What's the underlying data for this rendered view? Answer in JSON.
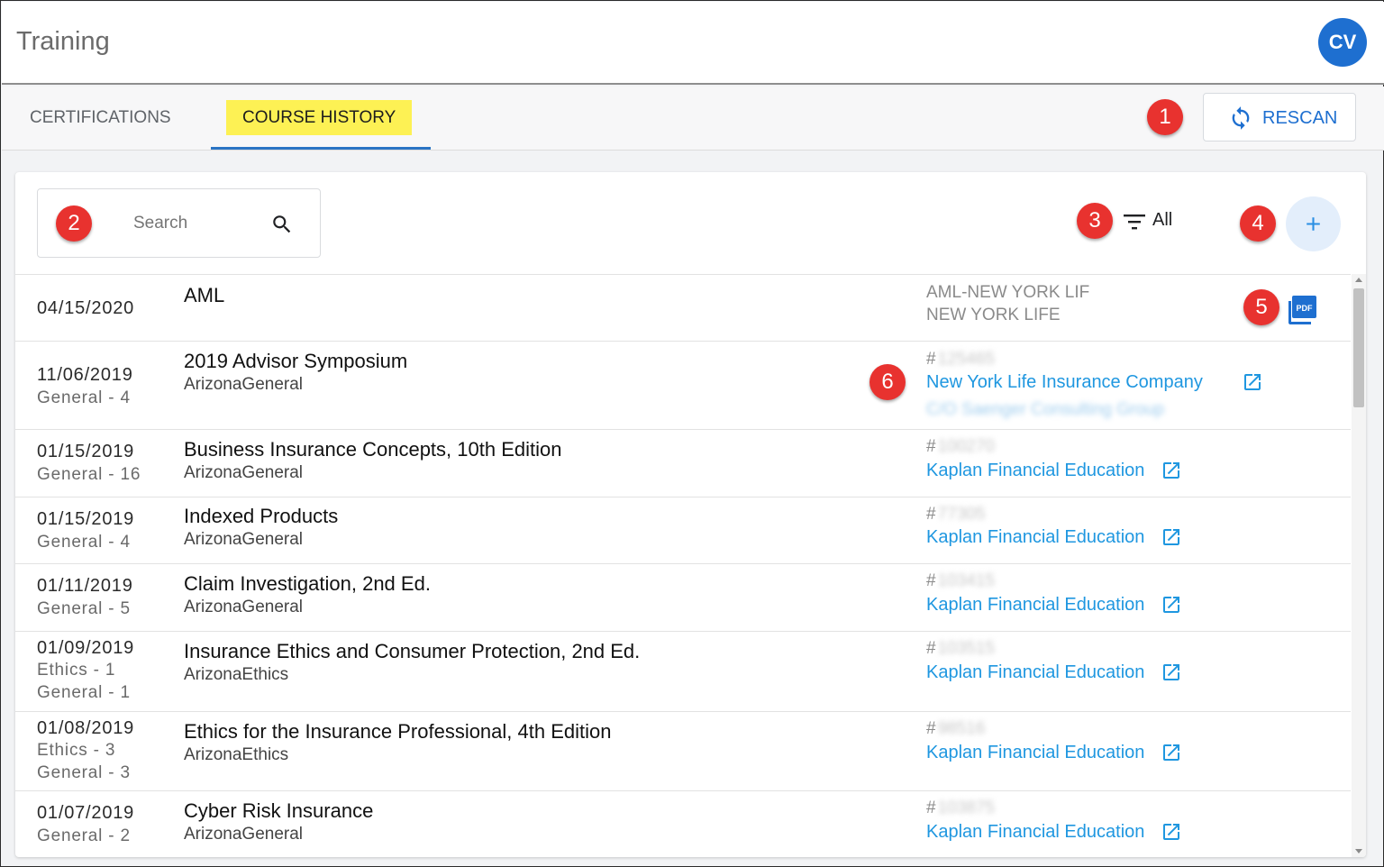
{
  "header": {
    "title": "Training",
    "avatar_initials": "CV"
  },
  "tabs": [
    {
      "label": "CERTIFICATIONS",
      "active": false
    },
    {
      "label": "COURSE HISTORY",
      "active": true
    }
  ],
  "toolbar": {
    "rescan_label": "RESCAN"
  },
  "search": {
    "placeholder": "Search"
  },
  "filter": {
    "label": "All"
  },
  "courses": [
    {
      "date": "04/15/2020",
      "credits": [],
      "title": "AML",
      "category": "",
      "provider_line1": "AML-NEW YORK LIF",
      "provider_line2": "NEW YORK LIFE",
      "has_pdf": true
    },
    {
      "date": "11/06/2019",
      "credits": [
        "General - 4"
      ],
      "title": "2019 Advisor Symposium",
      "category": "ArizonaGeneral",
      "number": "125465",
      "provider": "New York Life Insurance Company",
      "provider_extra": "C/O Saenger Consulting Group"
    },
    {
      "date": "01/15/2019",
      "credits": [
        "General - 16"
      ],
      "title": "Business Insurance Concepts, 10th Edition",
      "category": "ArizonaGeneral",
      "number": "100270",
      "provider": "Kaplan Financial Education"
    },
    {
      "date": "01/15/2019",
      "credits": [
        "General - 4"
      ],
      "title": "Indexed Products",
      "category": "ArizonaGeneral",
      "number": "77305",
      "provider": "Kaplan Financial Education"
    },
    {
      "date": "01/11/2019",
      "credits": [
        "General - 5"
      ],
      "title": "Claim Investigation, 2nd Ed.",
      "category": "ArizonaGeneral",
      "number": "103415",
      "provider": "Kaplan Financial Education"
    },
    {
      "date": "01/09/2019",
      "credits": [
        "Ethics - 1",
        "General - 1"
      ],
      "title": "Insurance Ethics and Consumer Protection, 2nd Ed.",
      "category": "ArizonaEthics",
      "number": "103515",
      "provider": "Kaplan Financial Education"
    },
    {
      "date": "01/08/2019",
      "credits": [
        "Ethics - 3",
        "General - 3"
      ],
      "title": "Ethics for the Insurance Professional, 4th Edition",
      "category": "ArizonaEthics",
      "number": "98516",
      "provider": "Kaplan Financial Education"
    },
    {
      "date": "01/07/2019",
      "credits": [
        "General - 2"
      ],
      "title": "Cyber Risk Insurance",
      "category": "ArizonaGeneral",
      "number": "103875",
      "provider": "Kaplan Financial Education"
    }
  ],
  "markers": [
    "1",
    "2",
    "3",
    "4",
    "5",
    "6"
  ],
  "colors": {
    "accent": "#1e6fd0",
    "link": "#1f97e0",
    "highlight": "#fdf154",
    "marker": "#e8322f"
  }
}
